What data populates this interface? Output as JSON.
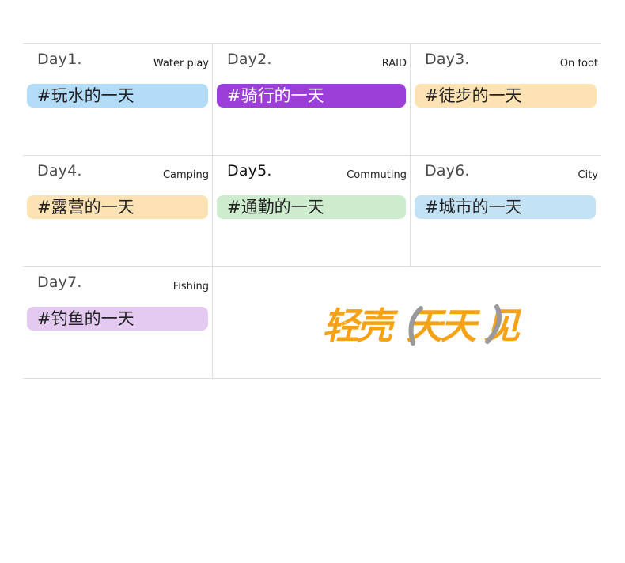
{
  "days": [
    {
      "day": "Day1.",
      "sub": "Water play",
      "tag": "#玩水的一天",
      "tag_color": "#b3dcf9"
    },
    {
      "day": "Day2.",
      "sub": "RAID",
      "tag": "#骑行的一天",
      "tag_color": "#9b3fd8"
    },
    {
      "day": "Day3.",
      "sub": "On foot",
      "tag": "#徒步的一天",
      "tag_color": "#fde2b4"
    },
    {
      "day": "Day4.",
      "sub": "Camping",
      "tag": "#露营的一天",
      "tag_color": "#fde2b4"
    },
    {
      "day": "Day5.",
      "sub": "Commuting",
      "tag": "#通勤的一天",
      "tag_color": "#cdeccd"
    },
    {
      "day": "Day6.",
      "sub": "City",
      "tag": "#城市的一天",
      "tag_color": "#c4e2f5"
    },
    {
      "day": "Day7.",
      "sub": "Fishing",
      "tag": "#钓鱼的一天",
      "tag_color": "#e4c9f1"
    }
  ],
  "brand": {
    "text": "轻壳天天见",
    "colors": {
      "orange": "#f5a216",
      "gray": "#9a9a9a"
    }
  }
}
